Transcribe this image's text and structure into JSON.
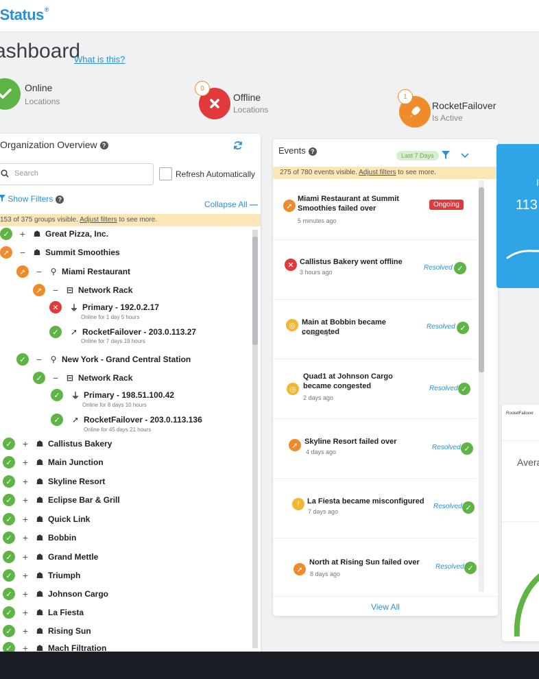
{
  "app": {
    "name": "iStatus",
    "trademark": "®"
  },
  "dashboard": {
    "title": "ashboard",
    "help_link": "What is this?"
  },
  "stats": [
    {
      "label": "Online",
      "sub": "Locations",
      "badge": ""
    },
    {
      "label": "Offline",
      "sub": "Locations",
      "badge": "0"
    },
    {
      "label": "RocketFailover",
      "sub": "Is Active",
      "badge": "1"
    }
  ],
  "org": {
    "title": "Organization Overview",
    "search_placeholder": "Search",
    "refresh_label": "Refresh Automatically",
    "show_filters": "Show Filters",
    "collapse_all": "Collapse All",
    "notice_text": "153 of 375 groups visible.",
    "notice_link": "Adjust filters",
    "notice_tail": "to see more.",
    "tree": [
      {
        "label": "Great Pizza, Inc.",
        "sub": ""
      },
      {
        "label": "Summit Smoothies",
        "sub": ""
      },
      {
        "label": "Miami Restaurant",
        "sub": ""
      },
      {
        "label": "Network Rack",
        "sub": ""
      },
      {
        "label": "Primary - 192.0.2.17",
        "sub": "Online for 1 day 5 hours"
      },
      {
        "label": "RocketFailover - 203.0.113.27",
        "sub": "Online for 7 days 19 hours"
      },
      {
        "label": "New York - Grand Central Station",
        "sub": ""
      },
      {
        "label": "Network Rack",
        "sub": ""
      },
      {
        "label": "Primary - 198.51.100.42",
        "sub": "Online for 8 days 10 hours"
      },
      {
        "label": "RocketFailover - 203.0.113.136",
        "sub": "Online for 45 days 21 hours"
      },
      {
        "label": "Callistus Bakery",
        "sub": ""
      },
      {
        "label": "Main Junction",
        "sub": ""
      },
      {
        "label": "Skyline Resort",
        "sub": ""
      },
      {
        "label": "Eclipse Bar & Grill",
        "sub": ""
      },
      {
        "label": "Quick Link",
        "sub": ""
      },
      {
        "label": "Bobbin",
        "sub": ""
      },
      {
        "label": "Grand Mettle",
        "sub": ""
      },
      {
        "label": "Triumph",
        "sub": ""
      },
      {
        "label": "Johnson Cargo",
        "sub": ""
      },
      {
        "label": "La Fiesta",
        "sub": ""
      },
      {
        "label": "Rising Sun",
        "sub": ""
      },
      {
        "label": "Mach Filtration",
        "sub": ""
      }
    ]
  },
  "events": {
    "title": "Events",
    "range": "Last 7 Days",
    "notice_text": "275 of 780 events visible.",
    "notice_link": "Adjust filters",
    "notice_tail": "to see more.",
    "view_all": "View All",
    "items": [
      {
        "title": "Miami Restaurant at Summit Smoothies failed over",
        "time": "5 minutes ago",
        "status": "Ongoing"
      },
      {
        "title": "Callistus Bakery went offline",
        "time": "3 hours ago",
        "status": "Resolved"
      },
      {
        "title": "Main at Bobbin became congested",
        "time": "2 days ago",
        "status": "Resolved"
      },
      {
        "title": "Quad1 at Johnson Cargo became congested",
        "time": "2 days ago",
        "status": "Resolved"
      },
      {
        "title": "Skyline Resort failed over",
        "time": "4 days ago",
        "status": "Resolved"
      },
      {
        "title": "La Fiesta became misconfigured",
        "time": "7 days ago",
        "status": "Resolved"
      },
      {
        "title": "North at Rising Sun failed over",
        "time": "8 days ago",
        "status": "Resolved"
      }
    ]
  },
  "right": {
    "blue_top": "I",
    "blue_value": "113",
    "small_label": "RocketFailover",
    "avg_label": "Avera"
  },
  "colors": {
    "green": "#5fb446",
    "orange": "#f08b2b",
    "red": "#e2393b",
    "yellow": "#f2b632",
    "blue": "#2b8fd6"
  }
}
